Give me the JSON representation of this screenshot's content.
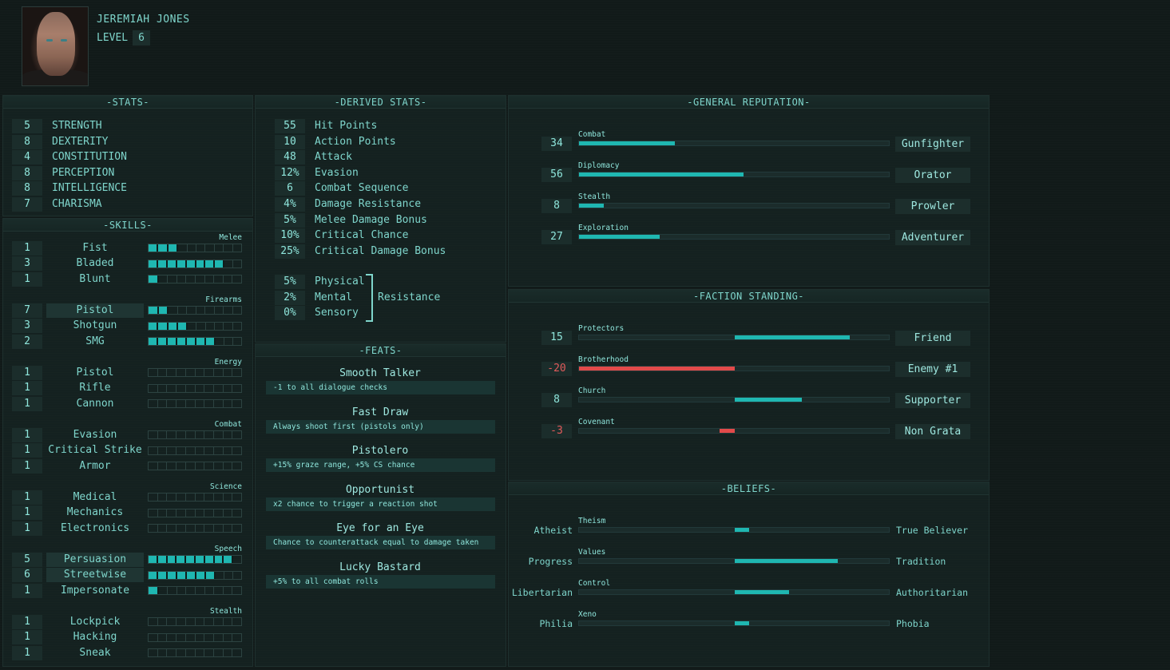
{
  "character": {
    "name": "JEREMIAH JONES",
    "level_label": "LEVEL",
    "level": "6"
  },
  "sections": {
    "stats": "-STATS-",
    "skills": "-SKILLS-",
    "derived": "-DERIVED STATS-",
    "feats": "-FEATS-",
    "reputation": "-GENERAL REPUTATION-",
    "faction": "-FACTION STANDING-",
    "beliefs": "-BELIEFS-"
  },
  "stats": [
    {
      "value": "5",
      "label": "STRENGTH"
    },
    {
      "value": "8",
      "label": "DEXTERITY"
    },
    {
      "value": "4",
      "label": "CONSTITUTION"
    },
    {
      "value": "8",
      "label": "PERCEPTION"
    },
    {
      "value": "8",
      "label": "INTELLIGENCE"
    },
    {
      "value": "7",
      "label": "CHARISMA"
    }
  ],
  "skill_groups": [
    {
      "category": "Melee",
      "skills": [
        {
          "value": "1",
          "name": "Fist",
          "bar": 3,
          "highlight": false
        },
        {
          "value": "3",
          "name": "Bladed",
          "bar": 8,
          "highlight": false
        },
        {
          "value": "1",
          "name": "Blunt",
          "bar": 1,
          "highlight": false
        }
      ]
    },
    {
      "category": "Firearms",
      "skills": [
        {
          "value": "7",
          "name": "Pistol",
          "bar": 2,
          "highlight": true
        },
        {
          "value": "3",
          "name": "Shotgun",
          "bar": 4,
          "highlight": false
        },
        {
          "value": "2",
          "name": "SMG",
          "bar": 7,
          "highlight": false
        }
      ]
    },
    {
      "category": "Energy",
      "skills": [
        {
          "value": "1",
          "name": "Pistol",
          "bar": 0,
          "highlight": false
        },
        {
          "value": "1",
          "name": "Rifle",
          "bar": 0,
          "highlight": false
        },
        {
          "value": "1",
          "name": "Cannon",
          "bar": 0,
          "highlight": false
        }
      ]
    },
    {
      "category": "Combat",
      "skills": [
        {
          "value": "1",
          "name": "Evasion",
          "bar": 0,
          "highlight": false
        },
        {
          "value": "1",
          "name": "Critical Strike",
          "bar": 0,
          "highlight": false
        },
        {
          "value": "1",
          "name": "Armor",
          "bar": 0,
          "highlight": false
        }
      ]
    },
    {
      "category": "Science",
      "skills": [
        {
          "value": "1",
          "name": "Medical",
          "bar": 0,
          "highlight": false
        },
        {
          "value": "1",
          "name": "Mechanics",
          "bar": 0,
          "highlight": false
        },
        {
          "value": "1",
          "name": "Electronics",
          "bar": 0,
          "highlight": false
        }
      ]
    },
    {
      "category": "Speech",
      "skills": [
        {
          "value": "5",
          "name": "Persuasion",
          "bar": 9,
          "highlight": true
        },
        {
          "value": "6",
          "name": "Streetwise",
          "bar": 7,
          "highlight": true
        },
        {
          "value": "1",
          "name": "Impersonate",
          "bar": 1,
          "highlight": false
        }
      ]
    },
    {
      "category": "Stealth",
      "skills": [
        {
          "value": "1",
          "name": "Lockpick",
          "bar": 0,
          "highlight": false
        },
        {
          "value": "1",
          "name": "Hacking",
          "bar": 0,
          "highlight": false
        },
        {
          "value": "1",
          "name": "Sneak",
          "bar": 0,
          "highlight": false
        }
      ]
    }
  ],
  "derived": [
    {
      "value": "55",
      "label": "Hit Points"
    },
    {
      "value": "10",
      "label": "Action Points"
    },
    {
      "value": "48",
      "label": "Attack"
    },
    {
      "value": "12%",
      "label": "Evasion"
    },
    {
      "value": "6",
      "label": "Combat Sequence"
    },
    {
      "value": "4%",
      "label": "Damage Resistance"
    },
    {
      "value": "5%",
      "label": "Melee Damage Bonus"
    },
    {
      "value": "10%",
      "label": "Critical Chance"
    },
    {
      "value": "25%",
      "label": "Critical Damage Bonus"
    }
  ],
  "resistance": {
    "label": "Resistance",
    "items": [
      {
        "value": "5%",
        "label": "Physical"
      },
      {
        "value": "2%",
        "label": "Mental"
      },
      {
        "value": "0%",
        "label": "Sensory"
      }
    ]
  },
  "feats": [
    {
      "title": "Smooth Talker",
      "desc": "-1 to all dialogue checks"
    },
    {
      "title": "Fast Draw",
      "desc": "Always shoot first (pistols only)"
    },
    {
      "title": "Pistolero",
      "desc": "+15% graze range, +5% CS chance"
    },
    {
      "title": "Opportunist",
      "desc": "x2 chance to trigger a reaction shot"
    },
    {
      "title": "Eye for an Eye",
      "desc": "Chance to counterattack equal to damage taken"
    },
    {
      "title": "Lucky Bastard",
      "desc": "+5% to all combat rolls"
    }
  ],
  "reputation": [
    {
      "value": "34",
      "name": "Combat",
      "fill": 0.31,
      "title": "Gunfighter"
    },
    {
      "value": "56",
      "name": "Diplomacy",
      "fill": 0.53,
      "title": "Orator"
    },
    {
      "value": "8",
      "name": "Stealth",
      "fill": 0.08,
      "title": "Prowler"
    },
    {
      "value": "27",
      "name": "Exploration",
      "fill": 0.26,
      "title": "Adventurer"
    }
  ],
  "factions": [
    {
      "value": "15",
      "name": "Protectors",
      "level": 0.74,
      "title": "Friend",
      "negative": false
    },
    {
      "value": "-20",
      "name": "Brotherhood",
      "level": -1.0,
      "title": "Enemy #1",
      "negative": true
    },
    {
      "value": "8",
      "name": "Church",
      "level": 0.43,
      "title": "Supporter",
      "negative": false
    },
    {
      "value": "-3",
      "name": "Covenant",
      "level": -0.1,
      "title": "Non Grata",
      "negative": true
    }
  ],
  "beliefs": [
    {
      "left": "Atheist",
      "name": "Theism",
      "level": 0.09,
      "right": "True Believer"
    },
    {
      "left": "Progress",
      "name": "Values",
      "level": 0.66,
      "right": "Tradition"
    },
    {
      "left": "Libertarian",
      "name": "Control",
      "level": 0.35,
      "right": "Authoritarian"
    },
    {
      "left": "Philia",
      "name": "Xeno",
      "level": 0.09,
      "right": "Phobia"
    }
  ],
  "colors": {
    "accent": "#1fb7b1",
    "negative": "#e24a4a",
    "text": "#7fd6cc",
    "background": "#111a19"
  }
}
